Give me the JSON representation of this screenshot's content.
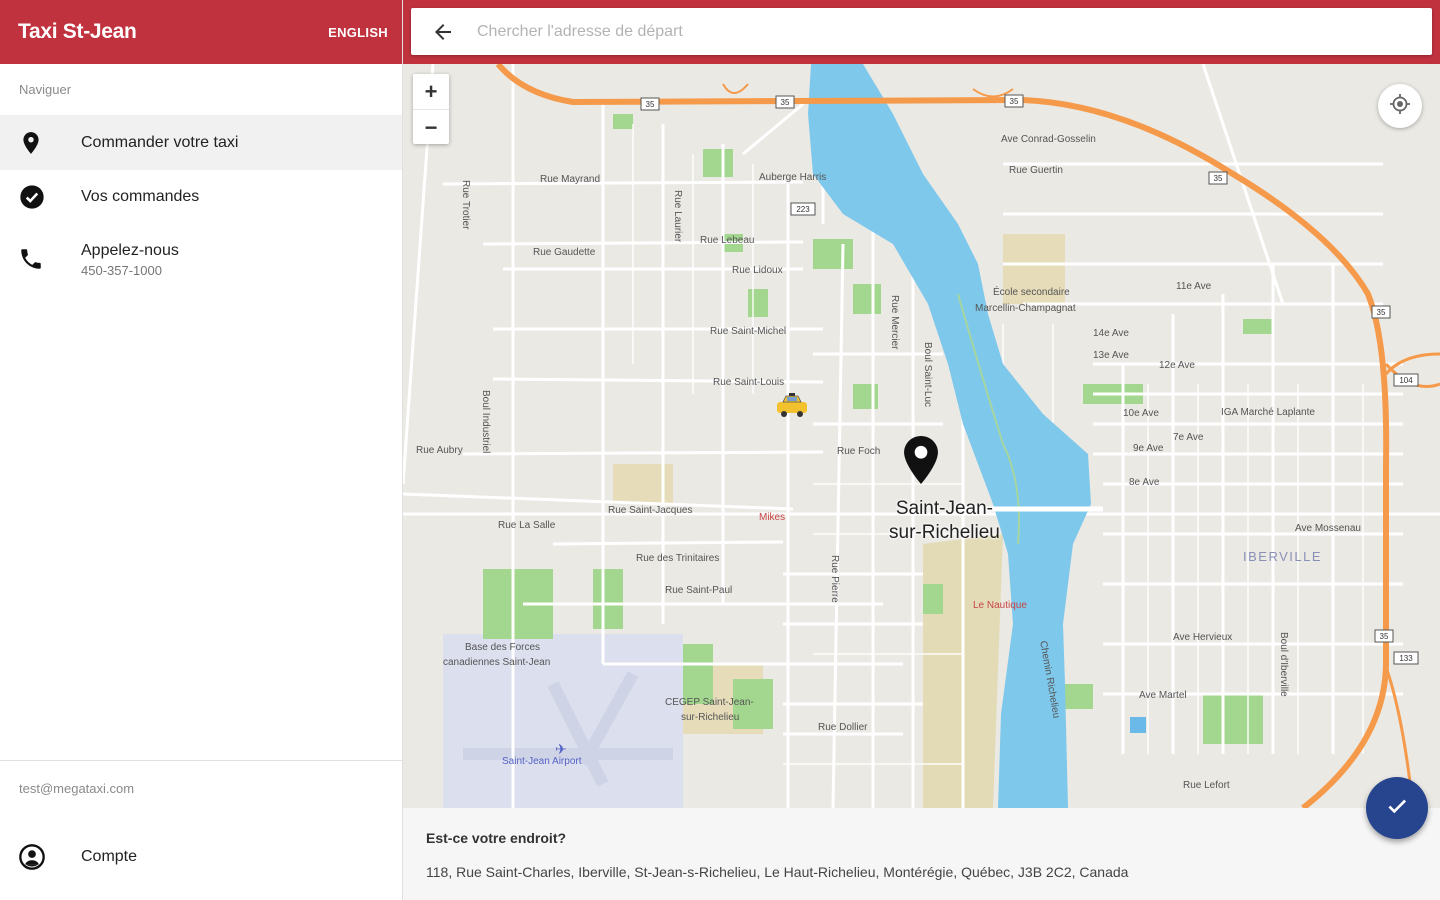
{
  "app": {
    "title": "Taxi St-Jean",
    "language_button": "ENGLISH"
  },
  "sidebar": {
    "section_label": "Naviguer",
    "items": [
      {
        "label": "Commander votre taxi",
        "icon": "location-pin-icon"
      },
      {
        "label": "Vos commandes",
        "icon": "check-circle-icon"
      },
      {
        "label": "Appelez-nous",
        "sub": "450-357-1000",
        "icon": "phone-icon"
      }
    ],
    "email": "test@megataxi.com",
    "account_label": "Compte"
  },
  "search": {
    "placeholder": "Chercher l'adresse de départ"
  },
  "map": {
    "zoom_in": "+",
    "zoom_out": "−",
    "city_line1": "Saint-Jean-",
    "city_line2": "sur-Richelieu",
    "district": "IBERVILLE",
    "street_labels": [
      "Rue Mayrand",
      "Auberge Harris",
      "Rue Laurier",
      "Rue Gaudette",
      "Rue Lebeau",
      "Rue Lidoux",
      "Rue Saint-Michel",
      "Rue Saint-Louis",
      "Rue Foch",
      "Rue Saint-Jacques",
      "Rue La Salle",
      "Rue des Trinitaires",
      "Rue Saint-Paul",
      "Rue Dollier",
      "Base des Forces",
      "canadiennes Saint-Jean",
      "Saint-Jean Airport",
      "CEGEP Saint-Jean-",
      "sur-Richelieu",
      "École secondaire",
      "Marcellin-Champagnat",
      "Ave Conrad-Gosselin",
      "Rue Guertin",
      "11e Ave",
      "14e Ave",
      "13e Ave",
      "12e Ave",
      "IGA Marché Laplante",
      "10e Ave",
      "9e Ave",
      "8e Ave",
      "7e Ave",
      "Ave Mossenau",
      "Ave Hervieux",
      "Ave Martel",
      "Rue Lefort",
      "Mikes",
      "Le Nautique",
      "Boul Industriel",
      "Rue Trotier",
      "Rue Aubry",
      "Rue Pierre",
      "Rue Mercier",
      "Boul Saint-Luc",
      "Chemin Richelieu",
      "Boul d'Iberville"
    ],
    "route_shields": [
      "35",
      "35",
      "35",
      "35",
      "35",
      "104",
      "133",
      "223",
      "35",
      "133"
    ]
  },
  "bottom": {
    "question": "Est-ce votre endroit?",
    "address": "118, Rue Saint-Charles, Iberville, St-Jean-s-Richelieu, Le Haut-Richelieu, Montérégie, Québec, J3B 2C2, Canada"
  },
  "colors": {
    "primary": "#c1323f",
    "fab": "#27458f",
    "river": "#7ec8ec",
    "highway": "#f59a4a",
    "park": "#a3d78f",
    "road": "#ffffff"
  }
}
